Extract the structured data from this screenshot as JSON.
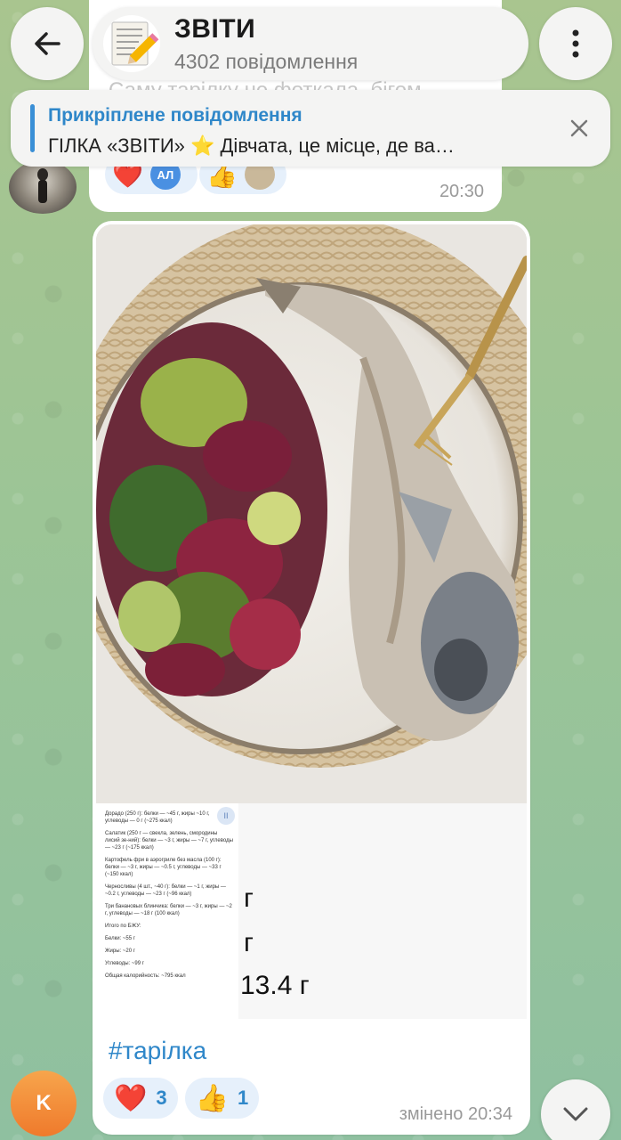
{
  "header": {
    "title": "ЗВІТИ",
    "subtitle": "4302 повідомлення"
  },
  "pinned": {
    "label": "Прикріплене повідомлення",
    "text_before": "ГІЛКА «ЗВІТИ»",
    "star": "⭐",
    "text_after": "Дівчата, це місце, де ва…"
  },
  "previous_message": {
    "faded_text": "Саму тарілку не фоткала, бігом",
    "reactions": [
      {
        "emoji": "❤️",
        "badge": "АЛ"
      },
      {
        "emoji": "👍",
        "badge": ""
      }
    ],
    "time": "20:30"
  },
  "message": {
    "screenshot_items": [
      "Дорадо (250 г): белки — ~45 г, жиры ~10 г, углеводы — 0 г (~275 ккал)",
      "Салатик (250 г — свекла, зелень, смородины лисий зе-ний): белки — ~3 г, жиры — ~7 г, углеводы — ~23 г (~175 ккал)",
      "Картофель фри в аэрогриле без масла (100 г): белки — ~3 г, жиры — ~0.5 г, углеводы — ~33 г (~150 ккал)",
      "Черносливы (4 шт., ~40 г): белки — ~1 г, жиры — ~0.2 г, углеводы — ~23 г (~96 ккал)",
      "Три банановых блинчика: белки — ~3 г, жиры — ~2 г, углеводы — ~18 г (100 ккал)",
      "Итого по БЖУ:",
      "Белки: ~55 г",
      "Жиры: ~20 г",
      "Углеводы: ~99 г",
      "Общая калорийность: ~795 ккал"
    ],
    "big_g_1": "г",
    "big_g_2": "г",
    "big_value": "13.4 г",
    "hashtag": "#тарілка",
    "reactions": [
      {
        "emoji": "❤️",
        "count": "3"
      },
      {
        "emoji": "👍",
        "count": "1"
      }
    ],
    "edited": "змінено 20:34"
  },
  "floating": {
    "avatar_letter": "K"
  }
}
